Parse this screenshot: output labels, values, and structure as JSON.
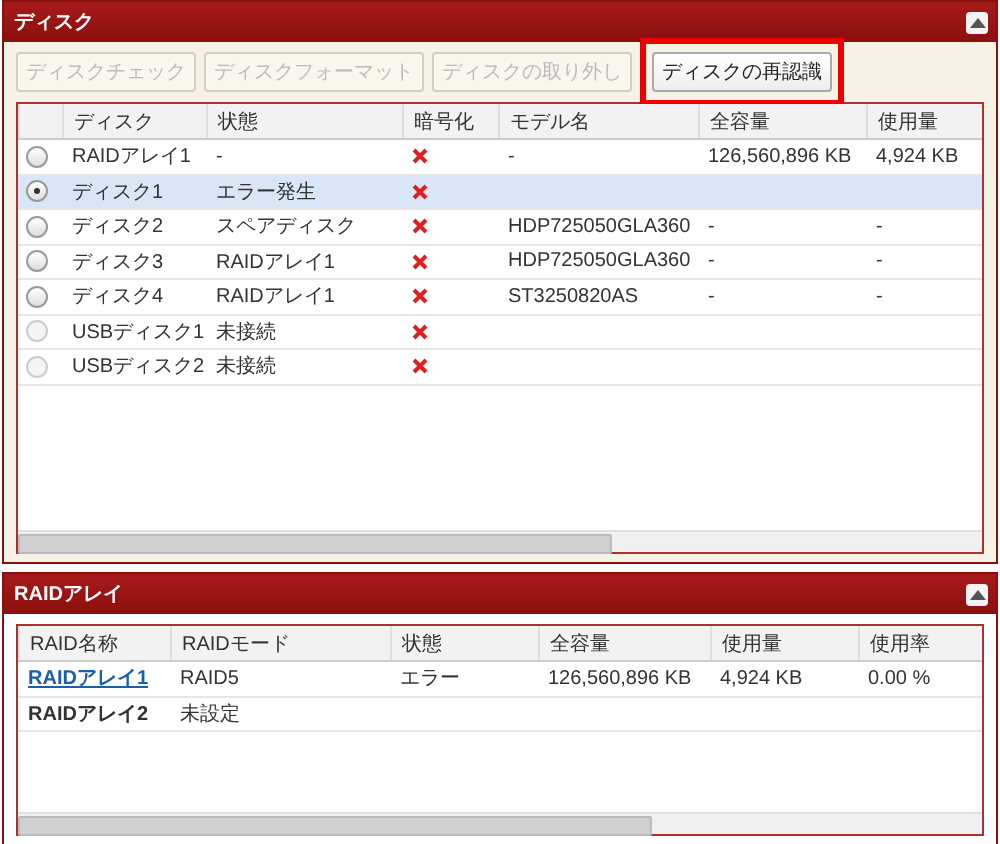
{
  "disk_panel": {
    "title": "ディスク",
    "toolbar": [
      {
        "label": "ディスクチェック",
        "disabled": true,
        "highlighted": false
      },
      {
        "label": "ディスクフォーマット",
        "disabled": true,
        "highlighted": false
      },
      {
        "label": "ディスクの取り外し",
        "disabled": true,
        "highlighted": false
      },
      {
        "label": "ディスクの再認識",
        "disabled": false,
        "highlighted": true
      }
    ],
    "table": {
      "columns": [
        "ディスク",
        "状態",
        "暗号化",
        "モデル名",
        "全容量",
        "使用量"
      ],
      "rows": [
        {
          "selected": false,
          "disabled": false,
          "encrypted": false,
          "cells": [
            "RAIDアレイ1",
            "-",
            "",
            "-",
            "126,560,896 KB",
            "4,924 KB"
          ]
        },
        {
          "selected": true,
          "disabled": false,
          "encrypted": false,
          "cells": [
            "ディスク1",
            "エラー発生",
            "",
            "",
            "",
            ""
          ]
        },
        {
          "selected": false,
          "disabled": false,
          "encrypted": false,
          "cells": [
            "ディスク2",
            "スペアディスク",
            "",
            "HDP725050GLA360",
            "-",
            "-"
          ]
        },
        {
          "selected": false,
          "disabled": false,
          "encrypted": false,
          "cells": [
            "ディスク3",
            "RAIDアレイ1",
            "",
            "HDP725050GLA360",
            "-",
            "-"
          ]
        },
        {
          "selected": false,
          "disabled": false,
          "encrypted": false,
          "cells": [
            "ディスク4",
            "RAIDアレイ1",
            "",
            "ST3250820AS",
            "-",
            "-"
          ]
        },
        {
          "selected": false,
          "disabled": true,
          "encrypted": false,
          "cells": [
            "USBディスク1",
            "未接続",
            "",
            "",
            "",
            ""
          ]
        },
        {
          "selected": false,
          "disabled": true,
          "encrypted": false,
          "cells": [
            "USBディスク2",
            "未接続",
            "",
            "",
            "",
            ""
          ]
        }
      ]
    }
  },
  "raid_panel": {
    "title": "RAIDアレイ",
    "table": {
      "columns": [
        "RAID名称",
        "RAIDモード",
        "状態",
        "全容量",
        "使用量",
        "使用率"
      ],
      "rows": [
        {
          "kind": "link",
          "cells": [
            "RAIDアレイ1",
            "RAID5",
            "エラー",
            "126,560,896 KB",
            "4,924 KB",
            "0.00 %"
          ]
        },
        {
          "kind": "bold",
          "cells": [
            "RAIDアレイ2",
            "未設定",
            "",
            "",
            "",
            ""
          ]
        }
      ]
    }
  }
}
